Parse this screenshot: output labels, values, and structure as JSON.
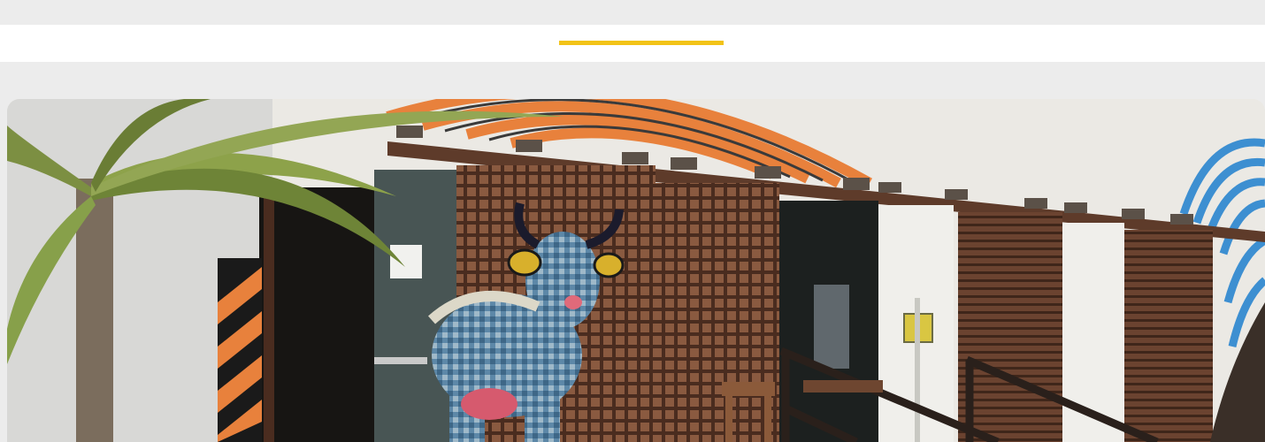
{
  "colors": {
    "page_background": "#ececec",
    "header_background": "#ffffff",
    "accent": "#f2c318",
    "wall": "#ebe9e4",
    "wood": "#5e3b2a",
    "orange_stripe": "#e8813c",
    "blue_stripe": "#3d8fd1"
  },
  "hero": {
    "icon": "photo-storefront-with-cow-sculpture-icon"
  }
}
